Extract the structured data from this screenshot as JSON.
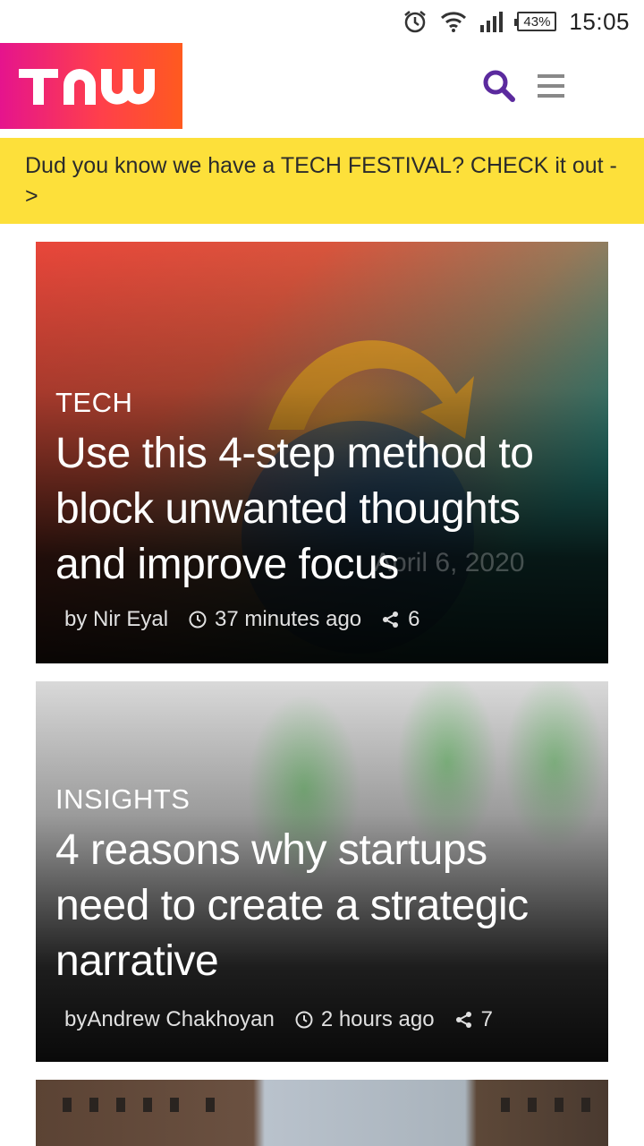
{
  "status_bar": {
    "battery": "43%",
    "time": "15:05",
    "icons": [
      "alarm-icon",
      "wifi-icon",
      "signal-icon",
      "battery-icon"
    ]
  },
  "header": {
    "logo_text": "TNW",
    "icons": [
      "search-icon",
      "hamburger-menu-icon"
    ],
    "accent_color": "#5b2a9e"
  },
  "banner": {
    "text": "Dud you know we have a TECH FESTIVAL? CHECK it out ->",
    "background": "#fde03a"
  },
  "articles": [
    {
      "category": "TECH",
      "title": "Use this 4-step method to block unwanted thoughts and improve focus",
      "ghost_date": "April 6, 2020",
      "author": "by Nir Eyal",
      "time": "37 minutes ago",
      "shares": "6"
    },
    {
      "category": "INSIGHTS",
      "title": "4 reasons why startups need to create a strategic narrative",
      "author": "byAndrew Chakhoyan",
      "time": "2 hours ago",
      "shares": "7"
    }
  ]
}
